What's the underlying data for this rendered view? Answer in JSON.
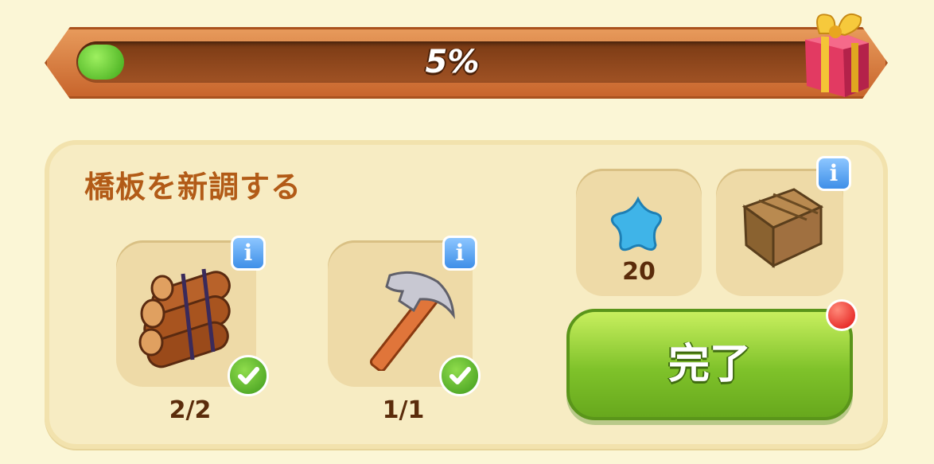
{
  "progress": {
    "percent_text": "5%",
    "fraction": 0.05
  },
  "task": {
    "title": "橋板を新調する",
    "requirements": [
      {
        "name": "logs",
        "icon": "log-bundle-icon",
        "count": "2/2",
        "complete": true
      },
      {
        "name": "hammer",
        "icon": "hammer-icon",
        "count": "1/1",
        "complete": true
      }
    ],
    "rewards": [
      {
        "icon": "blue-star-icon",
        "amount": "20"
      },
      {
        "icon": "wooden-crate-icon"
      }
    ],
    "complete_button": "完了"
  },
  "colors": {
    "title": "#b25b17",
    "button": "#7fc22a",
    "progress_fill": "#3ea818",
    "notify": "#e01010"
  }
}
